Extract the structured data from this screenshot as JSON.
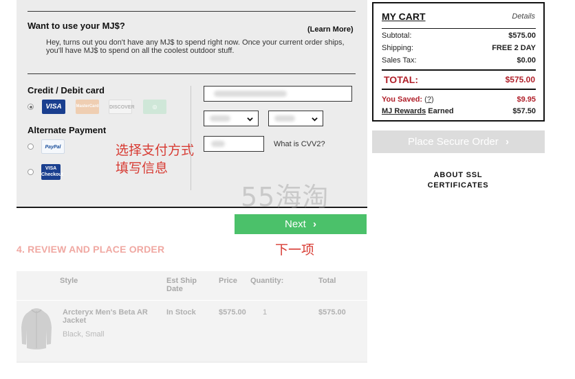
{
  "mj": {
    "title": "Want to use your MJ$?",
    "learn_more": "(Learn More)",
    "message": "Hey, turns out you don't have any MJ$ to spend right now. Once your current order ships, you'll have MJ$ to spend on all the coolest outdoor stuff."
  },
  "payment": {
    "credit_title": "Credit / Debit card",
    "alt_title": "Alternate Payment",
    "cards": [
      "VISA",
      "MasterCard",
      "DISCOVER",
      "Diners Club"
    ],
    "alt_methods": [
      "PayPal",
      "VISA Checkout"
    ],
    "cvv_label": "What is CVV2?",
    "hint_line1": "选择支付方式",
    "hint_line2": "填写信息"
  },
  "watermark": "55海淘",
  "next": {
    "label": "Next",
    "hint": "下一项"
  },
  "review": {
    "section_title": "4. REVIEW AND PLACE ORDER",
    "columns": [
      "Style",
      "Est Ship Date",
      "Price",
      "Quantity:",
      "Total"
    ],
    "items": [
      {
        "name": "Arcteryx Men's Beta AR Jacket",
        "variant": "Black, Small",
        "ship": "In Stock",
        "price": "$575.00",
        "quantity": "1",
        "total": "$575.00"
      }
    ]
  },
  "cart": {
    "title": "MY CART",
    "details": "Details",
    "subtotal_label": "Subtotal:",
    "subtotal": "$575.00",
    "shipping_label": "Shipping:",
    "shipping": "FREE 2 DAY",
    "tax_label": "Sales Tax:",
    "tax": "$0.00",
    "total_label": "TOTAL:",
    "total": "$575.00",
    "saved_label": "You Saved:",
    "saved_help": "?",
    "saved": "$9.95",
    "rewards_label_a": "MJ Rewards",
    "rewards_label_b": " Earned",
    "rewards": "$57.50"
  },
  "place_order": "Place Secure Order",
  "ssl": {
    "line1": "ABOUT SSL",
    "line2": "CERTIFICATES"
  },
  "colors": {
    "next": "#4bc16a",
    "hint": "#d73a32",
    "total": "#b0202a",
    "disabled": "#dcdcdc"
  }
}
